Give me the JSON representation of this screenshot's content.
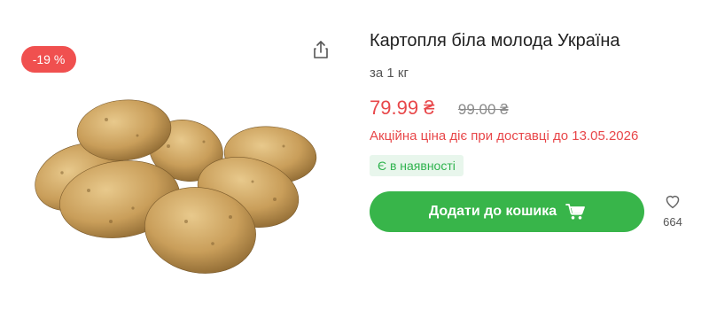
{
  "product": {
    "title": "Картопля біла молода Україна",
    "unit": "за 1 кг",
    "discount": "-19 %",
    "price_new": "79.99 ₴",
    "price_old": "99.00 ₴",
    "promo_text": "Акційна ціна діє при доставці до 13.05.2026",
    "stock_status": "Є в наявності",
    "add_to_cart_label": "Додати до кошика",
    "favorites_count": "664"
  },
  "colors": {
    "accent_green": "#38b54a",
    "sale_red": "#e8474a",
    "badge_red": "#f0504f",
    "stock_bg": "#e8f6ec"
  },
  "icons": [
    "share-icon",
    "cart-icon",
    "heart-icon"
  ]
}
